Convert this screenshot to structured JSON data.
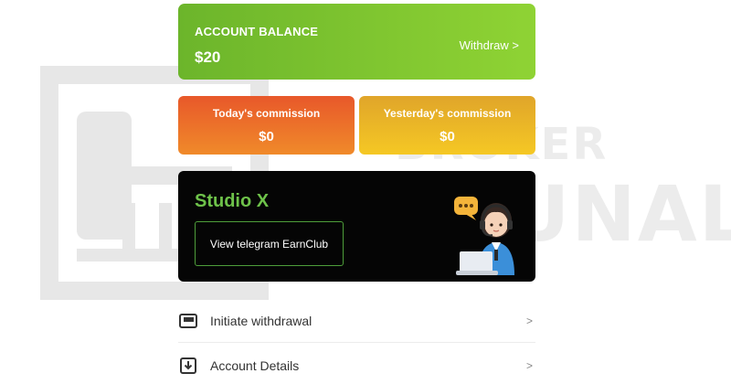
{
  "balance": {
    "label": "ACCOUNT BALANCE",
    "value": "$20",
    "withdraw_label": "Withdraw >"
  },
  "commissions": [
    {
      "label": "Today's commission",
      "value": "$0"
    },
    {
      "label": "Yesterday's commission",
      "value": "$0"
    }
  ],
  "promo": {
    "title": "Studio X",
    "button_label": "View telegram EarnClub",
    "chat_bubble": "..."
  },
  "menu": [
    {
      "label": "Initiate withdrawal",
      "chevron": ">",
      "icon": "wallet-icon"
    },
    {
      "label": "Account Details",
      "chevron": ">",
      "icon": "download-icon"
    }
  ],
  "watermark": {
    "line1": "BROKER",
    "line2": "TRIBUNAL"
  },
  "colors": {
    "balance_green": "#7cc42f",
    "today_orange": "#e96a2a",
    "yesterday_yellow": "#efb826",
    "studio_green": "#6ec24a",
    "card_black": "#050505"
  }
}
